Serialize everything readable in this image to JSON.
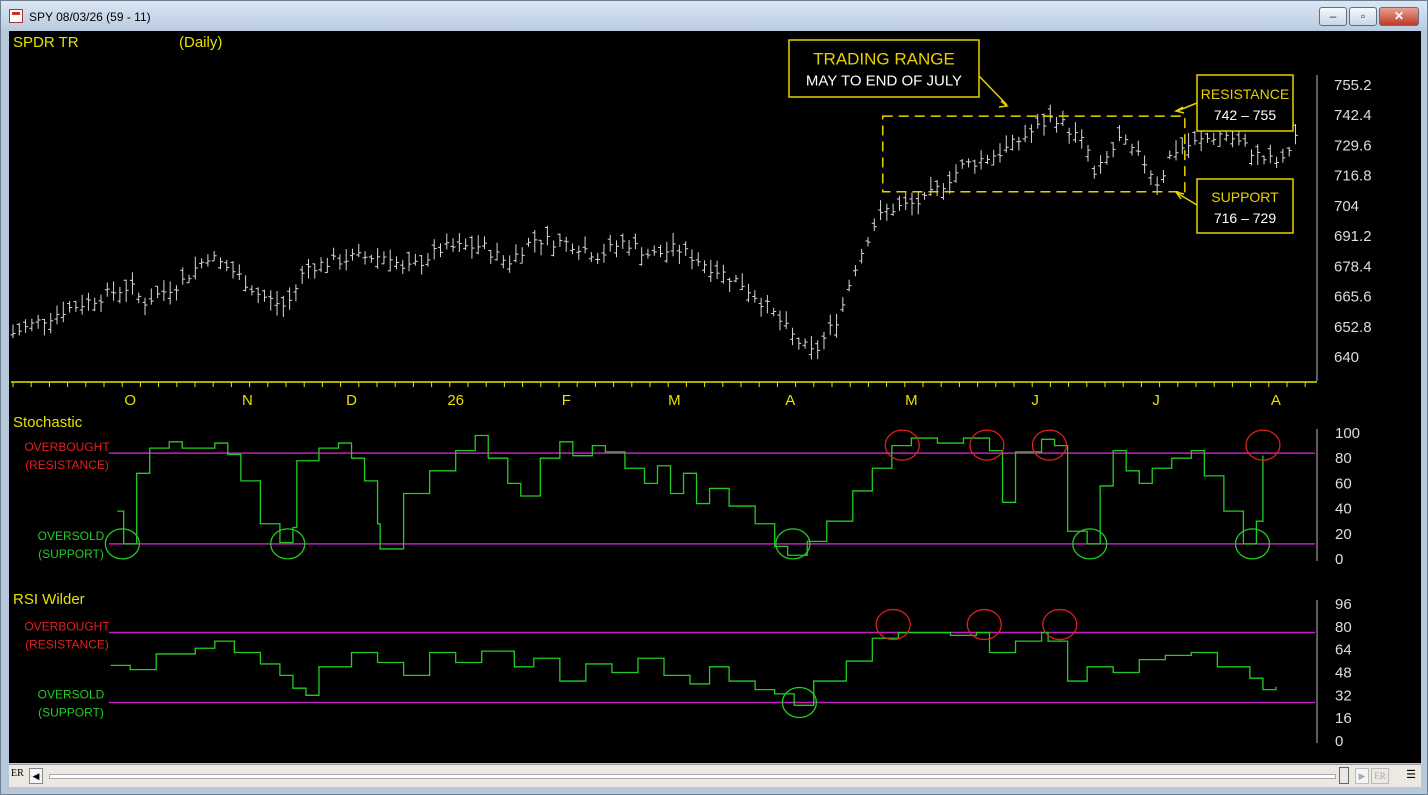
{
  "window": {
    "title": "SPY 08/03/26 (59 - 11)",
    "minimize": "‒",
    "maximize": "▫",
    "close": "✕"
  },
  "colors": {
    "background": "#000000",
    "label_yellow": "#e8e000",
    "price_bar": "#d8d8d8",
    "indicator": "#22cc22",
    "level_line": "#c020c0",
    "overbought": "#e02020",
    "oversold": "#22cc22",
    "annotation": "#e8d000"
  },
  "statusbar": {
    "left_label": "ER",
    "right_label": "ER",
    "left_arrow": "◀",
    "right_arrow": "▶",
    "menu_icon": "☰"
  },
  "chart_data": [
    {
      "type": "bar",
      "subtype": "ohlc",
      "title": "SPDR TR",
      "period": "(Daily)",
      "yticks": [
        755.2,
        742.4,
        729.6,
        716.8,
        704,
        691.2,
        678.4,
        665.6,
        652.8,
        640
      ],
      "ylim": [
        640,
        755.2
      ],
      "month_labels": [
        "O",
        "N",
        "D",
        "26",
        "F",
        "M",
        "A",
        "M",
        "J",
        "J",
        "A"
      ],
      "close_path": [
        [
          0,
          650
        ],
        [
          0.04,
          660
        ],
        [
          0.06,
          664
        ],
        [
          0.09,
          670
        ],
        [
          0.1,
          663
        ],
        [
          0.13,
          672
        ],
        [
          0.15,
          683
        ],
        [
          0.17,
          676
        ],
        [
          0.19,
          666
        ],
        [
          0.21,
          661
        ],
        [
          0.225,
          678
        ],
        [
          0.26,
          682
        ],
        [
          0.29,
          683
        ],
        [
          0.3,
          676
        ],
        [
          0.33,
          686
        ],
        [
          0.36,
          687
        ],
        [
          0.38,
          680
        ],
        [
          0.4,
          690
        ],
        [
          0.43,
          688
        ],
        [
          0.45,
          683
        ],
        [
          0.47,
          689
        ],
        [
          0.49,
          683
        ],
        [
          0.51,
          686
        ],
        [
          0.53,
          680
        ],
        [
          0.56,
          671
        ],
        [
          0.58,
          661
        ],
        [
          0.6,
          648
        ],
        [
          0.615,
          641
        ],
        [
          0.635,
          658
        ],
        [
          0.645,
          676
        ],
        [
          0.66,
          695
        ],
        [
          0.67,
          702
        ],
        [
          0.7,
          706
        ],
        [
          0.73,
          721
        ],
        [
          0.76,
          727
        ],
        [
          0.8,
          742
        ],
        [
          0.825,
          729
        ],
        [
          0.83,
          716
        ],
        [
          0.85,
          732
        ],
        [
          0.87,
          722
        ],
        [
          0.88,
          713
        ],
        [
          0.89,
          727
        ],
        [
          0.93,
          735
        ],
        [
          0.96,
          724
        ],
        [
          0.975,
          722
        ],
        [
          0.985,
          734
        ]
      ],
      "annotations": [
        {
          "line1": "TRADING RANGE",
          "line2": "MAY TO END OF JULY"
        },
        {
          "line1": "RESISTANCE",
          "line2": "742 – 755"
        },
        {
          "line1": "SUPPORT",
          "line2": "716 – 729"
        }
      ],
      "trading_range": {
        "top": 742,
        "bottom": 710
      }
    },
    {
      "type": "line",
      "title": "Stochastic",
      "yticks": [
        100,
        80,
        60,
        40,
        20,
        0
      ],
      "ylim": [
        0,
        100
      ],
      "levels": {
        "overbought": 84,
        "oversold": 12
      },
      "overbought_label": [
        "OVERBOUGHT",
        "(RESISTANCE)"
      ],
      "oversold_label": [
        "OVERSOLD",
        "(SUPPORT)"
      ],
      "path": [
        [
          0.08,
          38
        ],
        [
          0.085,
          12
        ],
        [
          0.095,
          68
        ],
        [
          0.105,
          88
        ],
        [
          0.12,
          93
        ],
        [
          0.13,
          88
        ],
        [
          0.155,
          92
        ],
        [
          0.165,
          83
        ],
        [
          0.175,
          62
        ],
        [
          0.19,
          28
        ],
        [
          0.205,
          13
        ],
        [
          0.215,
          25
        ],
        [
          0.218,
          78
        ],
        [
          0.235,
          88
        ],
        [
          0.25,
          92
        ],
        [
          0.26,
          80
        ],
        [
          0.27,
          62
        ],
        [
          0.28,
          28
        ],
        [
          0.282,
          8
        ],
        [
          0.3,
          52
        ],
        [
          0.32,
          70
        ],
        [
          0.34,
          86
        ],
        [
          0.355,
          98
        ],
        [
          0.365,
          80
        ],
        [
          0.38,
          60
        ],
        [
          0.39,
          50
        ],
        [
          0.405,
          80
        ],
        [
          0.42,
          93
        ],
        [
          0.43,
          82
        ],
        [
          0.445,
          90
        ],
        [
          0.455,
          85
        ],
        [
          0.47,
          72
        ],
        [
          0.485,
          60
        ],
        [
          0.495,
          74
        ],
        [
          0.505,
          52
        ],
        [
          0.515,
          68
        ],
        [
          0.525,
          44
        ],
        [
          0.535,
          56
        ],
        [
          0.55,
          42
        ],
        [
          0.57,
          28
        ],
        [
          0.585,
          10
        ],
        [
          0.595,
          3
        ],
        [
          0.61,
          14
        ],
        [
          0.625,
          30
        ],
        [
          0.645,
          54
        ],
        [
          0.66,
          72
        ],
        [
          0.675,
          90
        ],
        [
          0.69,
          96
        ],
        [
          0.71,
          92
        ],
        [
          0.73,
          96
        ],
        [
          0.75,
          86
        ],
        [
          0.76,
          45
        ],
        [
          0.77,
          85
        ],
        [
          0.79,
          95
        ],
        [
          0.8,
          90
        ],
        [
          0.81,
          22
        ],
        [
          0.825,
          12
        ],
        [
          0.835,
          58
        ],
        [
          0.845,
          86
        ],
        [
          0.855,
          70
        ],
        [
          0.865,
          60
        ],
        [
          0.875,
          72
        ],
        [
          0.89,
          80
        ],
        [
          0.905,
          86
        ],
        [
          0.915,
          66
        ],
        [
          0.93,
          38
        ],
        [
          0.945,
          12
        ],
        [
          0.955,
          30
        ],
        [
          0.96,
          82
        ]
      ]
    },
    {
      "type": "line",
      "title": "RSI Wilder",
      "yticks": [
        96,
        80,
        64,
        48,
        32,
        16,
        0
      ],
      "ylim": [
        0,
        96
      ],
      "levels": {
        "overbought": 76,
        "oversold": 27
      },
      "overbought_label": [
        "OVERBOUGHT",
        "(RESISTANCE)"
      ],
      "oversold_label": [
        "OVERSOLD",
        "(SUPPORT)"
      ],
      "path": [
        [
          0.075,
          53
        ],
        [
          0.09,
          50
        ],
        [
          0.11,
          61
        ],
        [
          0.14,
          65
        ],
        [
          0.155,
          70
        ],
        [
          0.17,
          62
        ],
        [
          0.19,
          54
        ],
        [
          0.205,
          46
        ],
        [
          0.215,
          37
        ],
        [
          0.225,
          32
        ],
        [
          0.235,
          52
        ],
        [
          0.26,
          62
        ],
        [
          0.28,
          55
        ],
        [
          0.3,
          46
        ],
        [
          0.32,
          62
        ],
        [
          0.34,
          55
        ],
        [
          0.36,
          63
        ],
        [
          0.385,
          52
        ],
        [
          0.4,
          58
        ],
        [
          0.42,
          42
        ],
        [
          0.44,
          54
        ],
        [
          0.46,
          48
        ],
        [
          0.48,
          58
        ],
        [
          0.5,
          46
        ],
        [
          0.52,
          40
        ],
        [
          0.535,
          52
        ],
        [
          0.55,
          42
        ],
        [
          0.57,
          36
        ],
        [
          0.585,
          33
        ],
        [
          0.6,
          25
        ],
        [
          0.615,
          42
        ],
        [
          0.64,
          56
        ],
        [
          0.66,
          72
        ],
        [
          0.68,
          76
        ],
        [
          0.7,
          76
        ],
        [
          0.72,
          74
        ],
        [
          0.74,
          76
        ],
        [
          0.75,
          62
        ],
        [
          0.77,
          70
        ],
        [
          0.79,
          76
        ],
        [
          0.795,
          70
        ],
        [
          0.81,
          42
        ],
        [
          0.825,
          52
        ],
        [
          0.845,
          48
        ],
        [
          0.865,
          57
        ],
        [
          0.885,
          60
        ],
        [
          0.905,
          62
        ],
        [
          0.925,
          52
        ],
        [
          0.95,
          44
        ],
        [
          0.96,
          36
        ],
        [
          0.97,
          38
        ]
      ]
    }
  ]
}
